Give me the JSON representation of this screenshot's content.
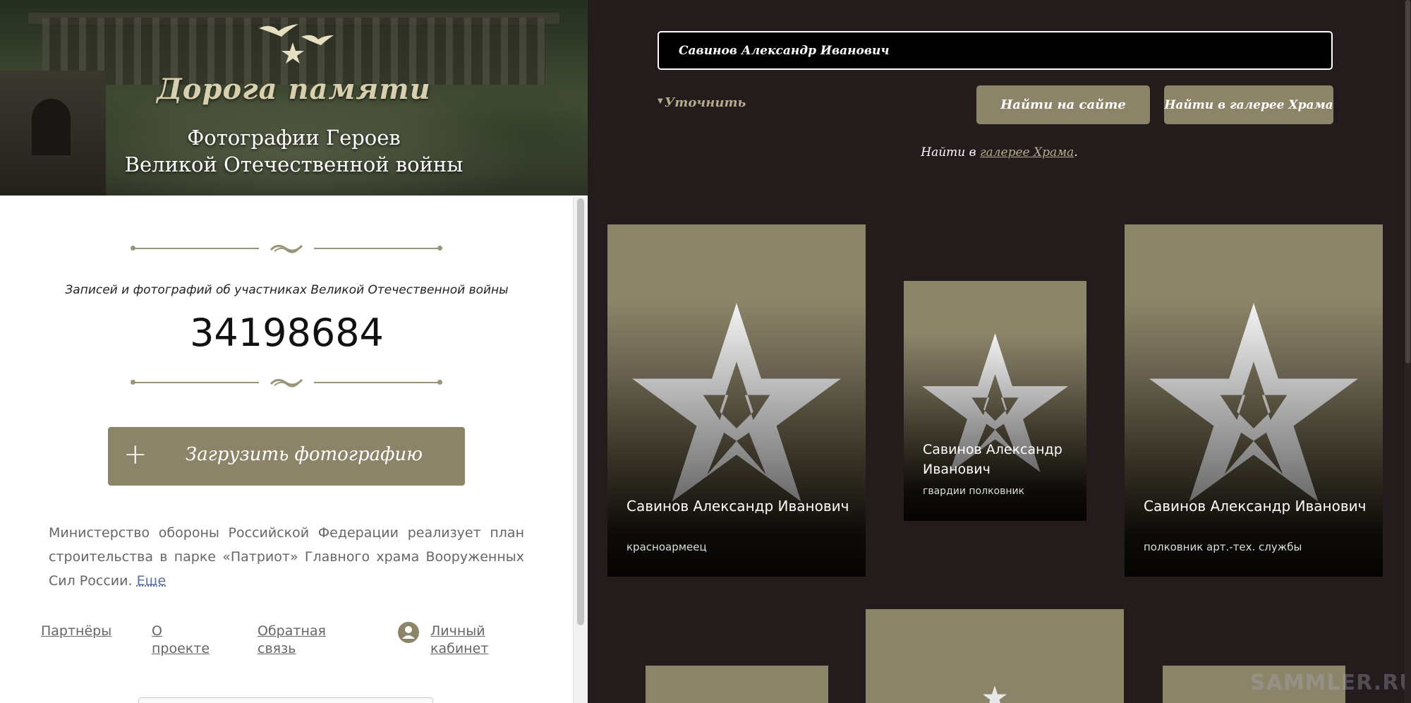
{
  "hero": {
    "logo_text": "Дорога памяти",
    "title_line1": "Фотографии Героев",
    "title_line2": "Великой Отечественной войны"
  },
  "stats": {
    "label": "Записей и фотографий об участниках Великой Отечественной войны",
    "count": "34198684"
  },
  "upload": {
    "plus": "+",
    "label": "Загрузить фотографию"
  },
  "about": {
    "text": "Министерство обороны Российской Федерации реализует план строительства в парке «Патриот» Главного храма Вооруженных Сил России.",
    "more": "Еще"
  },
  "footer": {
    "partners": "Партнёры",
    "about_project": "О проекте",
    "feedback": "Обратная связь",
    "cabinet": "Личный кабинет"
  },
  "search": {
    "value": "Савинов Александр Иванович",
    "refine": "Уточнить",
    "find_site": "Найти на сайте",
    "find_gallery": "Найти в галерее Храма",
    "hint_prefix": "Найти в ",
    "hint_link": "галерее Храма",
    "hint_suffix": "."
  },
  "results": [
    {
      "name": "Савинов Александр Иванович",
      "rank": "красноармеец"
    },
    {
      "name": "Савинов Александр Иванович",
      "rank": "гвардии полковник"
    },
    {
      "name": "Савинов Александр Иванович",
      "rank": "полковник арт.-тех. службы"
    }
  ],
  "watermark": "SAMMLER.RU",
  "colors": {
    "accent": "#8c8468",
    "dark_bg": "#231b1c",
    "link_gold": "#b4ab8a"
  },
  "icons": {
    "star": "star-icon",
    "user": "user-icon",
    "plus": "plus-icon"
  }
}
